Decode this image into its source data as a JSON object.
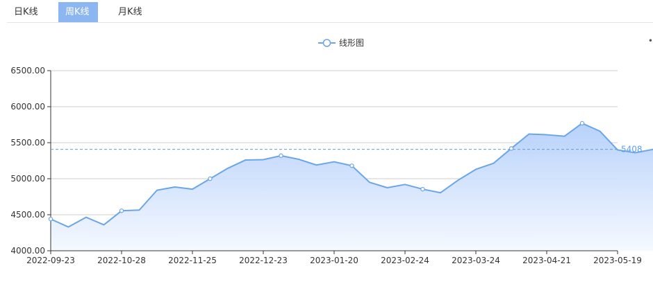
{
  "tabs": [
    {
      "label": "日K线",
      "active": false
    },
    {
      "label": "周K线",
      "active": true
    },
    {
      "label": "月K线",
      "active": false
    }
  ],
  "colors": {
    "line": "#6aa5e8",
    "fill_top": "#b3cffa",
    "fill_bottom": "#f4f8ff",
    "tab_active": "#8cb6f2",
    "mark_line": "#5b9fe0"
  },
  "chart_data": {
    "type": "area",
    "legend": {
      "label": "线形图",
      "position": "top-center"
    },
    "y_ticks": [
      "6500.00",
      "6000.00",
      "5500.00",
      "5000.00",
      "4500.00",
      "4000.00"
    ],
    "ylim": [
      4000,
      6500
    ],
    "x_tick_labels": [
      "2022-09-23",
      "2022-10-28",
      "2022-11-25",
      "2022-12-23",
      "2023-01-20",
      "2023-02-24",
      "2023-03-24",
      "2023-04-21",
      "2023-05-19"
    ],
    "grid": true,
    "series": [
      {
        "name": "线形图",
        "x": [
          "2022-09-23",
          "2022-09-30",
          "2022-10-07",
          "2022-10-14",
          "2022-10-21",
          "2022-10-28",
          "2022-11-04",
          "2022-11-11",
          "2022-11-18",
          "2022-11-25",
          "2022-12-02",
          "2022-12-09",
          "2022-12-16",
          "2022-12-23",
          "2022-12-30",
          "2023-01-06",
          "2023-01-13",
          "2023-01-20",
          "2023-01-27",
          "2023-02-03",
          "2023-02-10",
          "2023-02-17",
          "2023-02-24",
          "2023-03-03",
          "2023-03-10",
          "2023-03-17",
          "2023-03-24",
          "2023-03-31",
          "2023-04-07",
          "2023-04-14",
          "2023-04-21",
          "2023-04-28",
          "2023-05-05",
          "2023-05-12",
          "2023-05-19",
          "2023-05-26"
        ],
        "values": [
          4440,
          4330,
          4465,
          4360,
          4555,
          4565,
          4840,
          4885,
          4855,
          5000,
          5145,
          5260,
          5265,
          5320,
          5270,
          5190,
          5235,
          5180,
          4950,
          4875,
          4920,
          4855,
          4805,
          4980,
          5130,
          5215,
          5420,
          5620,
          5610,
          5590,
          5770,
          5660,
          5400,
          5360,
          5408,
          5408
        ]
      }
    ],
    "markers": [
      0,
      4,
      9,
      13,
      17,
      21,
      26,
      30
    ],
    "mark_line": {
      "value": 5408,
      "label": "5408"
    }
  }
}
